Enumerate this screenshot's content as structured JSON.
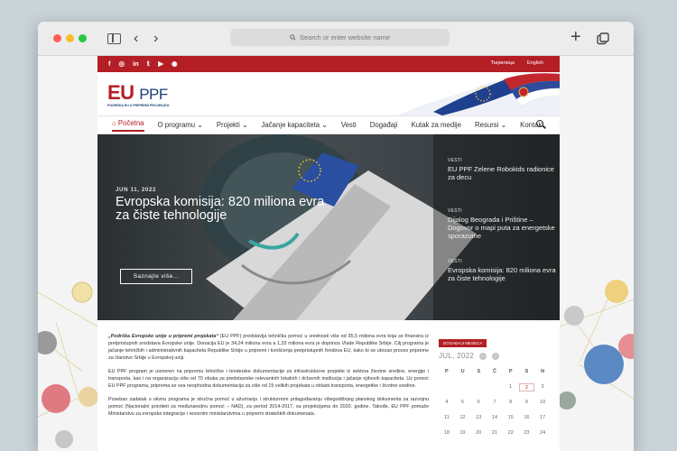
{
  "browser": {
    "url_placeholder": "Search or enter website name"
  },
  "site": {
    "social": [
      "f",
      "◎",
      "in",
      "𝕥",
      "▶",
      "◉"
    ],
    "languages": [
      "Ћирилица",
      "English"
    ],
    "logo": {
      "eu": "EU",
      "ppf": "PPF",
      "subtitle": "PODRŠKA EU U PRIPREMI PROJEKATA"
    },
    "nav": [
      {
        "label": "Početna",
        "dropdown": false,
        "active": true
      },
      {
        "label": "O programu",
        "dropdown": true
      },
      {
        "label": "Projekti",
        "dropdown": true
      },
      {
        "label": "Jačanje kapaciteta",
        "dropdown": true
      },
      {
        "label": "Vesti",
        "dropdown": false
      },
      {
        "label": "Događaji",
        "dropdown": false
      },
      {
        "label": "Kutak za medije",
        "dropdown": false
      },
      {
        "label": "Resursi",
        "dropdown": true
      },
      {
        "label": "Kontakt",
        "dropdown": false
      }
    ],
    "hero": {
      "date": "JUN 11, 2022",
      "title": "Evropska komisija: 820 miliona evra za čiste tehnologije",
      "button": "Saznajte više..."
    },
    "news": [
      {
        "category": "VESTI",
        "title": "EU PPF Zelene Robokids radionice za decu"
      },
      {
        "category": "VESTI",
        "title": "Dijalog Beograda i Prištine – Dogovor o mapi puta za energetske sporazume"
      },
      {
        "category": "VESTI",
        "title": "Evropska komisija: 820 miliona evra za čiste tehnologije"
      }
    ],
    "content": {
      "p1_emph": "„Podrška Evropske unije u pripremi projekata“",
      "p1_rest": " (EU PPF) predstavlja tehničku pomoć u vrednosti više od 35,5 miliona evra koja se finansira iz pretpristupnih sredstava Evropske unije. Donacija EU je 34,24 miliona evra a 1,33 miliona evra je doprinos Vlade Republike Srbije. Cilj programa je jačanje tehničkih i administrativnih kapaciteta Republike Srbije u pripremi i korišćenja pretpristupnih fondova EU, kako bi se ubrzao proces pripreme za članstvo Srbije u Evropskoj uniji.",
      "p2": "EU PPF program je usmeren na pripremu tehničke i tenderske dokumentacije za infrastrukturne projekte iz sektora životne sredine, energije i transporta, kao i na organizaciju više od 70 obuka za predstavnike relevantnih lokalnih i državnih institucija i jačanje njihovih kapaciteta. Uz pomoć EU PPF programa, priprema se sva neophodna dokumentacija za više od 15 velikih projekata u oblasti transporta, energetike i životne sredine.",
      "p3": "Poseban zadatak u okviru programa je stručna pomoć u ažuriranju i strukturnom prilagođavanju višegodišnjeg planskog dokumenta za razvojnu pomoć (Nacionalni prioriteti za međunarodnu pomoć – NAD), za period 2014-2017, sa projekcijama do 2020. godine. Takođe, EU PPF pomaže Ministarstvu za evropske integracije i resornim ministarstvima u pripremi strateških dokumenata."
    },
    "calendar": {
      "tab": "DOGAĐAJI MESECA",
      "month": "JUL, 2022",
      "prev": "‹",
      "next": "›",
      "weekdays": [
        "P",
        "U",
        "S",
        "Č",
        "P",
        "S",
        "N"
      ],
      "weeks": [
        [
          "",
          "",
          "",
          "",
          "1",
          "2",
          "3"
        ],
        [
          "4",
          "5",
          "6",
          "7",
          "8",
          "9",
          "10"
        ],
        [
          "11",
          "12",
          "13",
          "14",
          "15",
          "16",
          "17"
        ],
        [
          "18",
          "19",
          "20",
          "21",
          "22",
          "23",
          "24"
        ]
      ],
      "today": "2"
    }
  }
}
